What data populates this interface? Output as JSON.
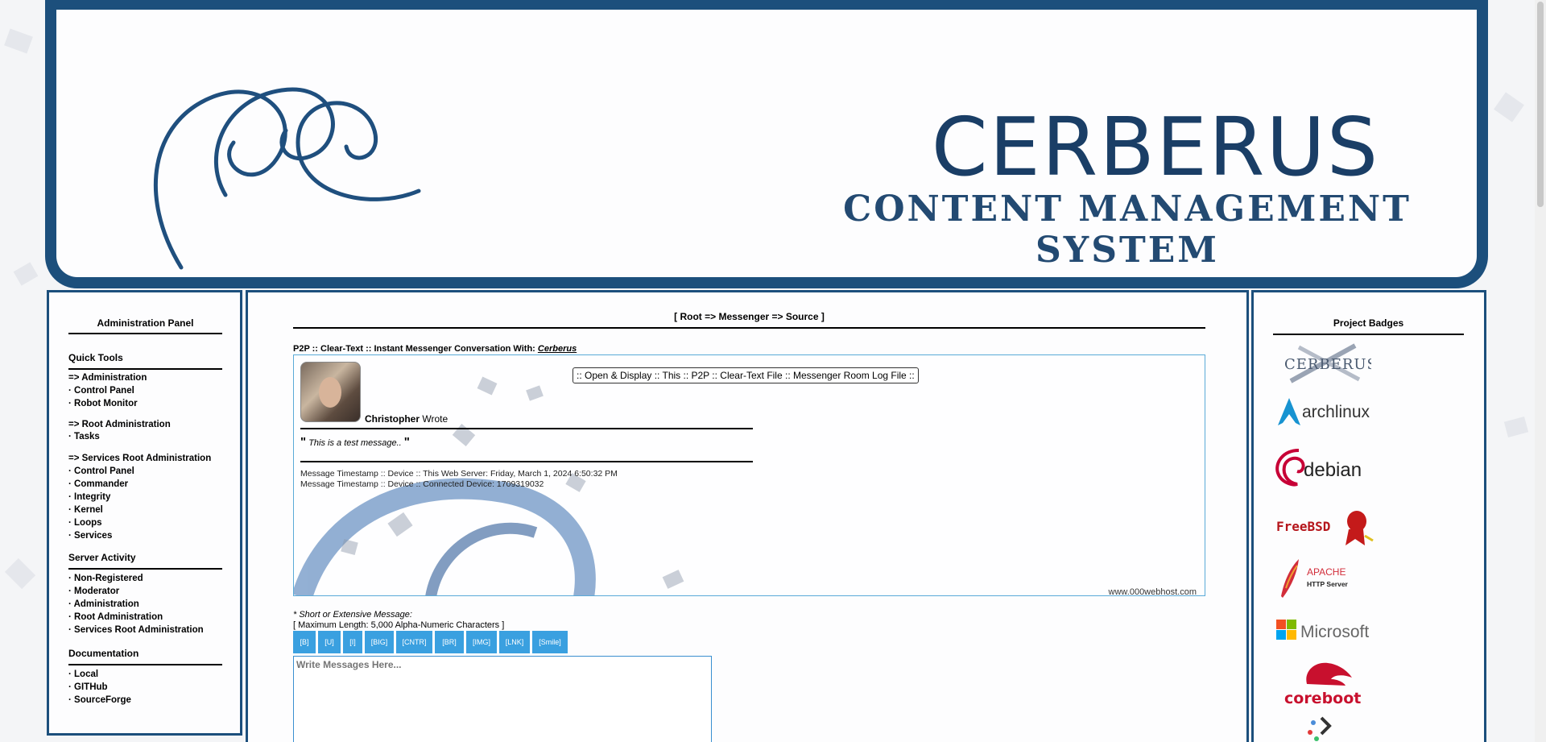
{
  "banner": {
    "title": "CERBERUS",
    "subtitle": "CONTENT MANAGEMENT SYSTEM"
  },
  "left_panel": {
    "title": "Administration Panel",
    "sections": [
      {
        "title": "Quick Tools"
      },
      {
        "title": "Server Activity"
      },
      {
        "title": "Documentation"
      }
    ],
    "quick_tools": {
      "administration_header": "=> Administration",
      "administration_items": [
        "· Control Panel",
        "· Robot Monitor"
      ],
      "root_header": "=> Root Administration",
      "root_items": [
        "· Tasks"
      ],
      "services_header": "=> Services Root Administration",
      "services_items": [
        "· Control Panel",
        "· Commander",
        "· Integrity",
        "· Kernel",
        "· Loops",
        "· Services"
      ]
    },
    "server_activity": [
      "· Non-Registered",
      "· Moderator",
      "· Administration",
      "· Root Administration",
      "· Services Root Administration"
    ],
    "documentation": [
      "· Local",
      "· GITHub",
      "· SourceForge"
    ]
  },
  "main": {
    "breadcrumb": "[ Root => Messenger => Source ]",
    "conversation_prefix": "P2P :: Clear-Text :: Instant Messenger Conversation With:",
    "conversation_user": "Cerberus",
    "open_log_button": ":: Open & Display :: This :: P2P :: Clear-Text File :: Messenger Room Log File ::",
    "message": {
      "author": "Christopher",
      "wrote": "Wrote",
      "text": "This is a test message..",
      "open_quote": "\"",
      "close_quote": "\"",
      "timestamp_server": "Message Timestamp :: Device :: This Web Server: Friday, March 1, 2024 6:50:32 PM",
      "timestamp_device": "Message Timestamp :: Device :: Connected Device: 1709319032",
      "footer": "www.000webhost.com"
    },
    "compose": {
      "label": "* Short or Extensive Message:",
      "max_length": "[ Maximum Length: 5,000 Alpha-Numeric Characters ]",
      "placeholder": "Write Messages Here...",
      "buttons": [
        "[B]",
        "[U]",
        "[I]",
        "[BIG]",
        "[CNTR]",
        "[BR]",
        "[IMG]",
        "[LNK]",
        "[Smile]"
      ]
    }
  },
  "right_panel": {
    "title": "Project Badges",
    "badges": [
      {
        "name": "cerberus-badge",
        "text": "CERBERUS"
      },
      {
        "name": "archlinux-badge",
        "text": "archlinux"
      },
      {
        "name": "debian-badge",
        "text": "debian"
      },
      {
        "name": "freebsd-badge",
        "text": "FreeBSD"
      },
      {
        "name": "apache-badge",
        "text": "APACHE",
        "sub": "HTTP Server"
      },
      {
        "name": "microsoft-badge",
        "text": "Microsoft"
      },
      {
        "name": "coreboot-badge",
        "text": "coreboot"
      }
    ]
  },
  "colors": {
    "brand": "#1c4f7c",
    "button": "#3aa0e0",
    "debian": "#c70036",
    "arch": "#1793d1",
    "coreboot": "#c8102e"
  }
}
